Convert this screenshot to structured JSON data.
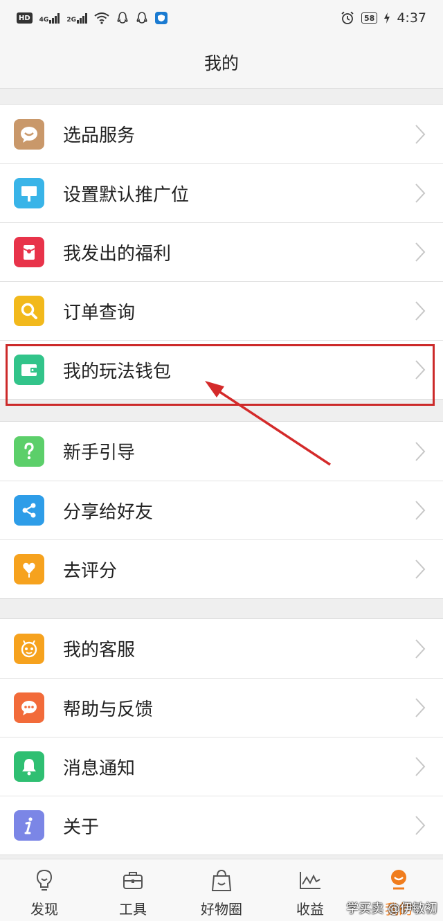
{
  "statusbar": {
    "hd": "HD",
    "net1": "4G",
    "net2": "2G",
    "battery": "58",
    "time": "4:37"
  },
  "header": {
    "title": "我的"
  },
  "groups": [
    {
      "items": [
        {
          "label": "选品服务",
          "icon": "chat-bubble-icon",
          "color": "#c9986a"
        },
        {
          "label": "设置默认推广位",
          "icon": "signboard-icon",
          "color": "#39b4e8"
        },
        {
          "label": "我发出的福利",
          "icon": "red-envelope-icon",
          "color": "#e8334a"
        },
        {
          "label": "订单查询",
          "icon": "magnifier-icon",
          "color": "#f2b91c"
        },
        {
          "label": "我的玩法钱包",
          "icon": "wallet-icon",
          "color": "#32c48a"
        }
      ]
    },
    {
      "items": [
        {
          "label": "新手引导",
          "icon": "question-icon",
          "color": "#5ccf6a"
        },
        {
          "label": "分享给好友",
          "icon": "share-icon",
          "color": "#2e9de8"
        },
        {
          "label": "去评分",
          "icon": "heart-flower-icon",
          "color": "#f6a21e"
        }
      ]
    },
    {
      "items": [
        {
          "label": "我的客服",
          "icon": "robot-face-icon",
          "color": "#f6a21e"
        },
        {
          "label": "帮助与反馈",
          "icon": "message-icon",
          "color": "#f26b3a"
        },
        {
          "label": "消息通知",
          "icon": "bell-icon",
          "color": "#2fbf72"
        },
        {
          "label": "关于",
          "icon": "info-icon",
          "color": "#7b86e6"
        }
      ]
    }
  ],
  "bottomnav": {
    "items": [
      {
        "label": "发现",
        "icon": "bulb-icon"
      },
      {
        "label": "工具",
        "icon": "toolbox-icon"
      },
      {
        "label": "好物圈",
        "icon": "shopping-bag-icon"
      },
      {
        "label": "收益",
        "icon": "chart-line-icon"
      },
      {
        "label": "我的",
        "icon": "profile-icon",
        "active": true
      }
    ]
  },
  "watermark": "学买卖 @伊敏初",
  "colors": {
    "accent": "#f07d1e",
    "highlight": "#cc2a2a"
  }
}
